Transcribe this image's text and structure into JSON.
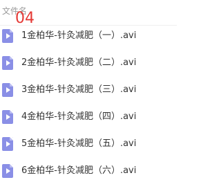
{
  "header": {
    "column_label": "文件名",
    "overlay_text": "04"
  },
  "files": [
    {
      "name": "1金柏华-针灸减肥（一）.avi",
      "icon": "video-file-icon"
    },
    {
      "name": "2金柏华-针灸减肥（二）.avi",
      "icon": "video-file-icon"
    },
    {
      "name": "3金柏华-针灸减肥（三）.avi",
      "icon": "video-file-icon"
    },
    {
      "name": "4金柏华-针灸减肥（四）.avi",
      "icon": "video-file-icon"
    },
    {
      "name": "5金柏华-针灸减肥（五）.avi",
      "icon": "video-file-icon"
    },
    {
      "name": "6金柏华-针灸减肥（六）.avi",
      "icon": "video-file-icon"
    }
  ],
  "colors": {
    "icon": "#8a8fe6",
    "overlay": "#e53935",
    "text": "#333333",
    "header_text": "#9a9a9a"
  }
}
